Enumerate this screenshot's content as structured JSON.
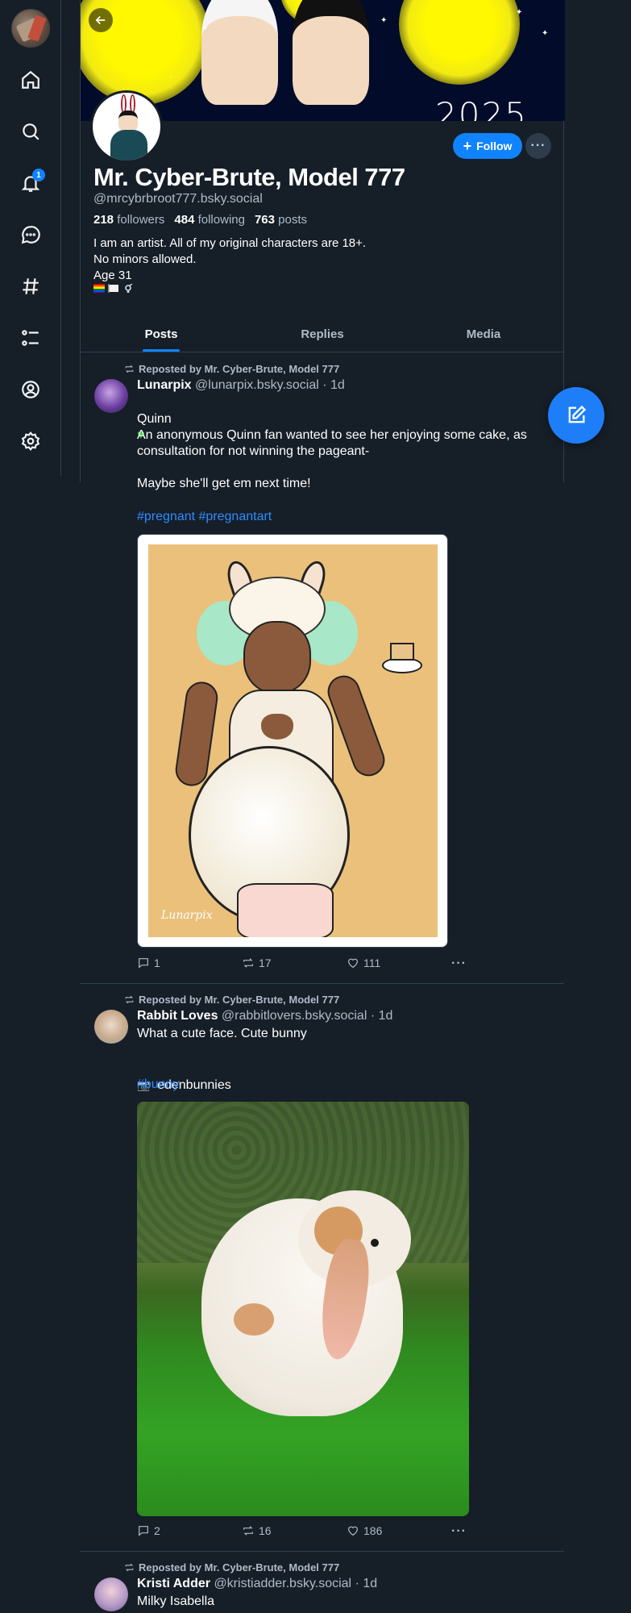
{
  "nav": {
    "items": [
      "home-icon",
      "search-icon",
      "notifications-icon",
      "chat-icon",
      "feeds-icon",
      "lists-icon",
      "profile-icon",
      "settings-icon"
    ],
    "notification_count": "1"
  },
  "profile": {
    "banner_year": "2025",
    "display_name": "Mr. Cyber-Brute, Model 777",
    "handle": "@mrcybrbroot777.bsky.social",
    "followers_count": "218",
    "followers_label": "followers",
    "following_count": "484",
    "following_label": "following",
    "posts_count": "763",
    "posts_label": "posts",
    "bio": "I am an artist.  All of my original characters are 18+.\nNo minors allowed.\nAge 31",
    "follow_label": "Follow",
    "more_label": "···"
  },
  "tabs": [
    {
      "label": "Posts",
      "active": true
    },
    {
      "label": "Replies",
      "active": false
    },
    {
      "label": "Media",
      "active": false
    }
  ],
  "posts": [
    {
      "repost_text": "Reposted by Mr. Cyber-Brute, Model 777",
      "author": "Lunarpix",
      "handle": "@lunarpix.bsky.social",
      "time": "· 1d",
      "text": "Quinn",
      "body": "An anonymous Quinn fan wanted to see her enjoying some cake, as consultation for not winning the pageant-\n\nMaybe she'll get em next time!",
      "tags": "#pregnant #pregnantart",
      "image_signature": "Lunarpix",
      "replies": "1",
      "reposts": "17",
      "likes": "111"
    },
    {
      "repost_text": "Reposted by Mr. Cyber-Brute, Model 777",
      "author": "Rabbit Loves",
      "handle": "@rabbitlovers.bsky.social",
      "time": "· 1d",
      "text": "What a cute face. Cute bunny",
      "credit": "edenbunnies",
      "tags": "#bunny",
      "replies": "2",
      "reposts": "16",
      "likes": "186"
    },
    {
      "repost_text": "Reposted by Mr. Cyber-Brute, Model 777",
      "author": "Kristi Adder",
      "handle": "@kristiadder.bsky.social",
      "time": "· 1d",
      "text": "Milky Isabella"
    }
  ],
  "colors": {
    "background": "#161e27",
    "accent": "#1083fe",
    "border": "#2e4052",
    "muted_text": "#aebbc9",
    "hashtag": "#2e8cff",
    "heart_emoji": "#2bcb2b"
  }
}
